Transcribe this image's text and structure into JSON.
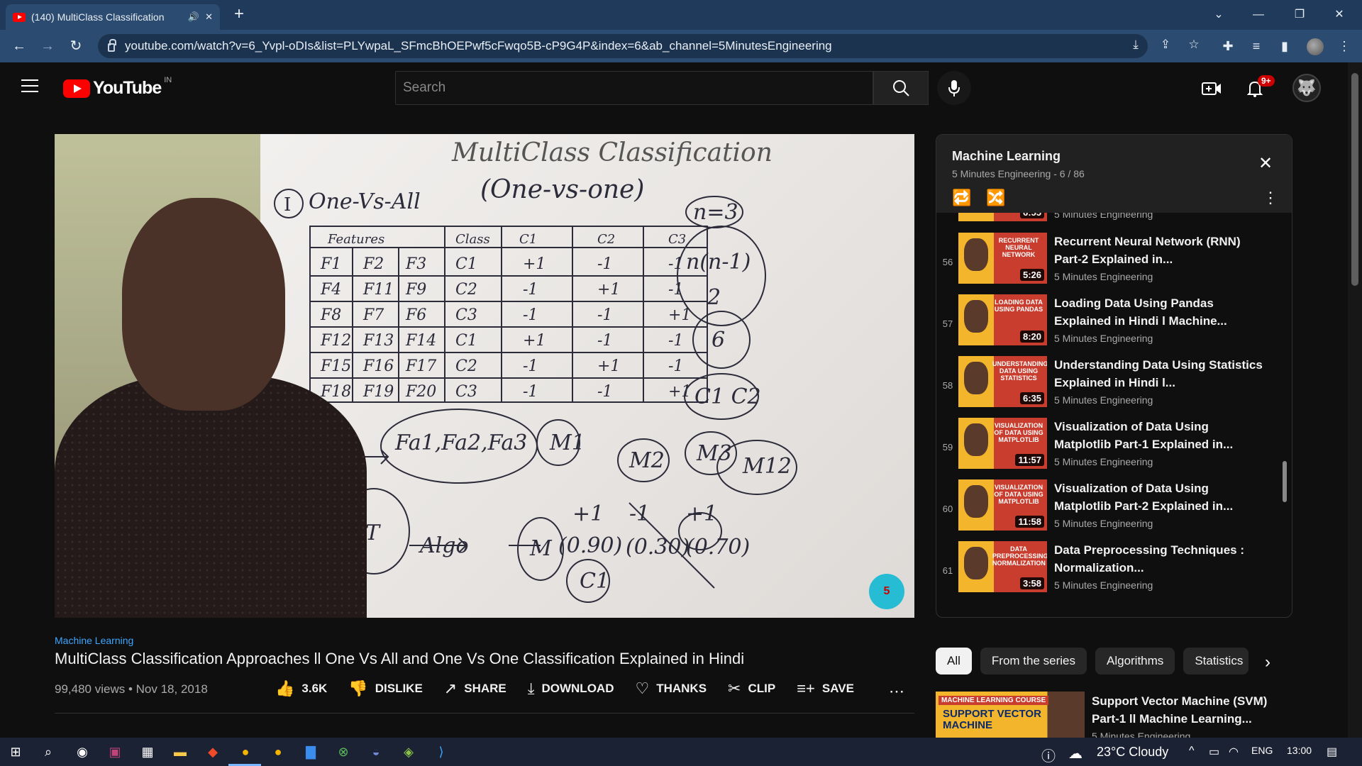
{
  "browser": {
    "tab_title": "(140) MultiClass Classification",
    "url": "youtube.com/watch?v=6_Yvpl-oDIs&list=PLYwpaL_SFmcBhOEPwf5cFwqo5B-cP9G4P&index=6&ab_channel=5MinutesEngineering"
  },
  "masthead": {
    "logo_text": "YouTube",
    "country_code": "IN",
    "search_placeholder": "Search",
    "notification_count": "9+"
  },
  "video": {
    "playlist_label": "Machine Learning",
    "title": "MultiClass Classification Approaches ll One Vs All and One Vs One Classification Explained in Hindi",
    "views": "99,480 views",
    "date": "Nov 18, 2018",
    "whiteboard": {
      "heading": "MultiClass Classification",
      "section1": "One-Vs-All",
      "section2": "(One-vs-one)",
      "table_headers": [
        "Features",
        "Class",
        "C1",
        "C2",
        "C3"
      ],
      "table_rows": [
        [
          "F1",
          "F2",
          "F3",
          "C1",
          "+1",
          "-1",
          "-1"
        ],
        [
          "F4",
          "F11",
          "F9",
          "C2",
          "-1",
          "+1",
          "-1"
        ],
        [
          "F8",
          "F7",
          "F6",
          "C3",
          "-1",
          "-1",
          "+1"
        ],
        [
          "F12",
          "F13",
          "F14",
          "C1",
          "+1",
          "-1",
          "-1"
        ],
        [
          "F15",
          "F16",
          "F17",
          "C2",
          "-1",
          "+1",
          "-1"
        ],
        [
          "F18",
          "F19",
          "F20",
          "C3",
          "-1",
          "-1",
          "+1"
        ]
      ]
    }
  },
  "actions": {
    "like": "3.6K",
    "dislike": "DISLIKE",
    "share": "SHARE",
    "download": "DOWNLOAD",
    "thanks": "THANKS",
    "clip": "CLIP",
    "save": "SAVE"
  },
  "playlist": {
    "title": "Machine Learning",
    "subtitle": "5 Minutes Engineering - 6 / 86",
    "partial_item": {
      "duration": "6:55",
      "channel": "5 Minutes Engineering"
    },
    "items": [
      {
        "index": "56",
        "thumb_text": "Recurrent Neural Network",
        "duration": "5:26",
        "title": "Recurrent Neural Network (RNN) Part-2 Explained in...",
        "channel": "5 Minutes Engineering"
      },
      {
        "index": "57",
        "thumb_text": "Loading Data Using Pandas",
        "duration": "8:20",
        "title": "Loading Data Using Pandas Explained in Hindi l Machine...",
        "channel": "5 Minutes Engineering"
      },
      {
        "index": "58",
        "thumb_text": "Understanding Data Using Statistics",
        "duration": "6:35",
        "title": "Understanding Data Using Statistics Explained in Hindi l...",
        "channel": "5 Minutes Engineering"
      },
      {
        "index": "59",
        "thumb_text": "Visualization of Data Using Matplotlib",
        "duration": "11:57",
        "title": "Visualization of Data Using Matplotlib Part-1 Explained in...",
        "channel": "5 Minutes Engineering"
      },
      {
        "index": "60",
        "thumb_text": "Visualization of Data Using Matplotlib",
        "duration": "11:58",
        "title": "Visualization of Data Using Matplotlib Part-2 Explained in...",
        "channel": "5 Minutes Engineering"
      },
      {
        "index": "61",
        "thumb_text": "Data Preprocessing Normalization",
        "duration": "3:58",
        "title": "Data Preprocessing Techniques : Normalization...",
        "channel": "5 Minutes Engineering"
      }
    ]
  },
  "chips": [
    "All",
    "From the series",
    "Algorithms",
    "Statistics"
  ],
  "recommended": {
    "thumb_tag": "MACHINE LEARNING COURSE",
    "thumb_big": "SUPPORT VECTOR MACHINE",
    "title": "Support Vector Machine (SVM) Part-1 ll Machine Learning...",
    "channel": "5 Minutes Engineering"
  },
  "taskbar": {
    "weather": "23°C Cloudy",
    "language": "ENG",
    "time": "13:00"
  }
}
